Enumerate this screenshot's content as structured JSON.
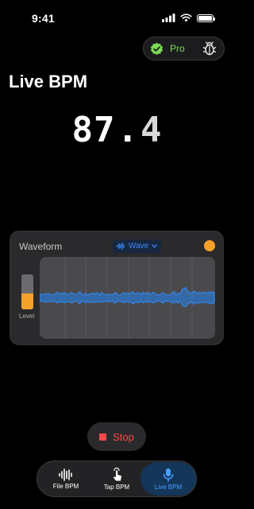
{
  "status_bar": {
    "time": "9:41"
  },
  "pro": {
    "label": "Pro"
  },
  "title": "Live BPM",
  "bpm": {
    "integer": "87",
    "separator": ".",
    "fraction": "4"
  },
  "waveform": {
    "title": "Waveform",
    "mode_selected": "Wave",
    "level_label": "Level",
    "level_fraction": 0.45
  },
  "controls": {
    "stop_label": "Stop"
  },
  "tabs": [
    {
      "label": "File BPM",
      "icon": "waveform-icon",
      "selected": false
    },
    {
      "label": "Tap BPM",
      "icon": "hand-tap-icon",
      "selected": false
    },
    {
      "label": "Live BPM",
      "icon": "microphone-icon",
      "selected": true
    }
  ],
  "colors": {
    "accent_blue": "#3d8bff",
    "pro_green": "#7ed957",
    "record_orange": "#f6a12a",
    "stop_red": "#ff4a4a"
  }
}
